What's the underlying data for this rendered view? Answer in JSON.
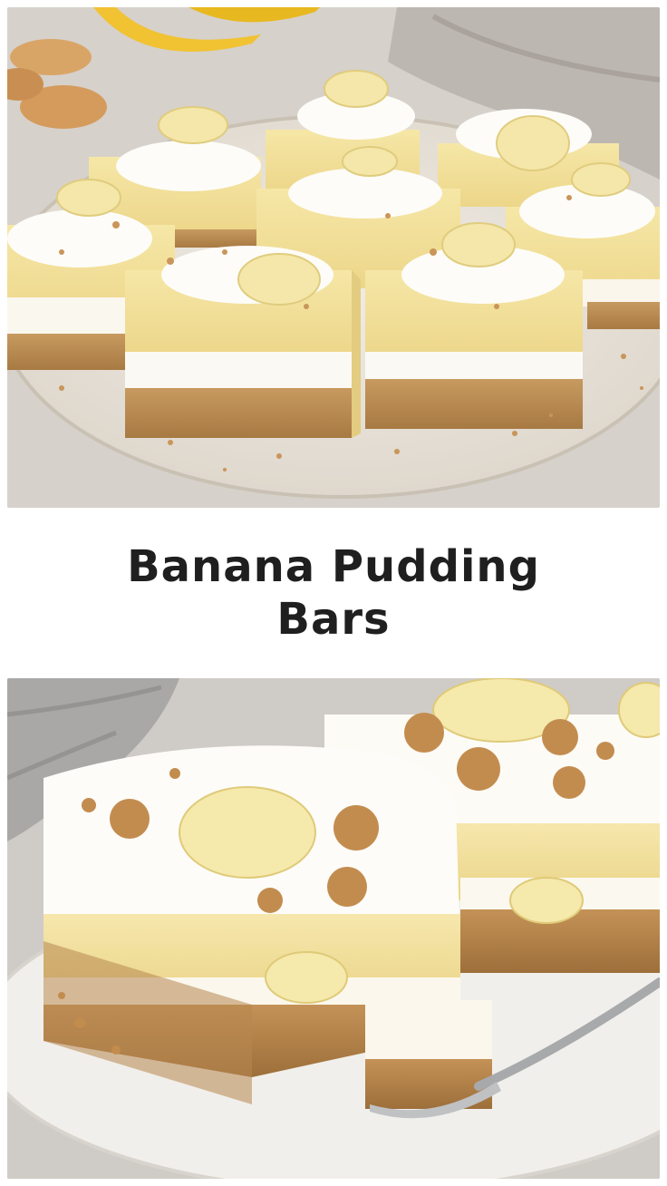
{
  "title": "Banana Pudding Bars",
  "photos": {
    "top": {
      "subject": "overhead-plated-bars"
    },
    "bottom": {
      "subject": "close-up-bar-with-fork"
    }
  },
  "colors": {
    "background": "#ffffff",
    "title": "#1f1f1f",
    "crust": "#b98a52",
    "pudding": "#f2df9a",
    "cream": "#fbf8f1",
    "banana": "#f3e6a8",
    "plate": "#ece7df"
  }
}
